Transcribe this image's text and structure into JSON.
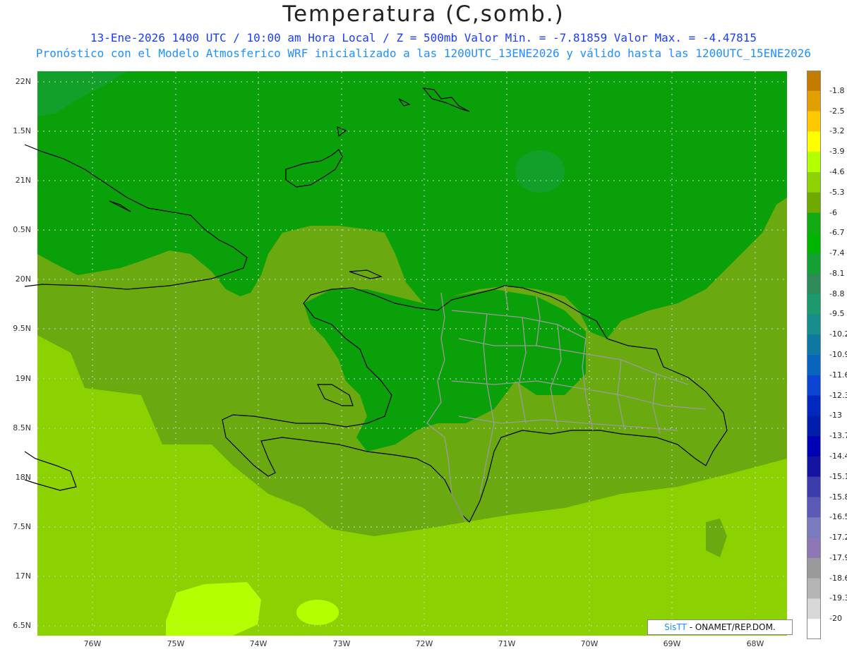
{
  "title": "Temperatura (C,somb.)",
  "subtitle_line1": "13-Ene-2026  1400 UTC / 10:00 am Hora Local / Z = 500mb  Valor Min. = -7.81859  Valor Max. = -4.47815",
  "subtitle_line2": "Pronóstico con el Modelo Atmosferico WRF inicializado a las 1200UTC_13ENE2026 y válido hasta las  1200UTC_15ENE2026",
  "lat_labels": [
    "22N",
    "1.5N",
    "21N",
    "0.5N",
    "20N",
    "9.5N",
    "19N",
    "8.5N",
    "18N",
    "7.5N",
    "17N",
    "6.5N"
  ],
  "lon_labels": [
    "76W",
    "75W",
    "74W",
    "73W",
    "72W",
    "71W",
    "70W",
    "69W",
    "68W"
  ],
  "colorbar": {
    "labels": [
      "-1.8",
      "-2.5",
      "-3.2",
      "-3.9",
      "-4.6",
      "-5.3",
      "-6",
      "-6.7",
      "-7.4",
      "-8.1",
      "-8.8",
      "-9.5",
      "-10.2",
      "-10.9",
      "-11.6",
      "-12.3",
      "-13",
      "-13.7",
      "-14.4",
      "-15.1",
      "-15.8",
      "-16.5",
      "-17.2",
      "-17.9",
      "-18.6",
      "-19.3",
      "-20"
    ],
    "colors": [
      "#c27c00",
      "#e0a000",
      "#ffc800",
      "#ffff00",
      "#b4ff00",
      "#8cd200",
      "#6eaa00",
      "#14aa14",
      "#00b400",
      "#14a032",
      "#2e8b57",
      "#1c9a6e",
      "#168c8c",
      "#0e78a0",
      "#0a64be",
      "#0a46d2",
      "#0028be",
      "#001eaa",
      "#0000b4",
      "#1414a0",
      "#3c3caa",
      "#5a5ab4",
      "#7a7abe",
      "#8c78b4",
      "#9a9a9a",
      "#b4b4b4",
      "#d8d8d8",
      "#ffffff"
    ]
  },
  "map_colors": {
    "c_minus6_to_minus6_7": "#0aa00a",
    "c_minus6_7_darker": "#12a02a",
    "c_minus5_3_to_minus6": "#6aaa10",
    "c_minus4_6_to_minus5_3": "#8cd200",
    "c_minus3_9_to_minus4_6": "#b4ff00",
    "coast": "#000000",
    "provinces": "#9a9a9a"
  },
  "credit": {
    "logo": "SisTT",
    "text": " - ONAMET/REP.DOM."
  }
}
